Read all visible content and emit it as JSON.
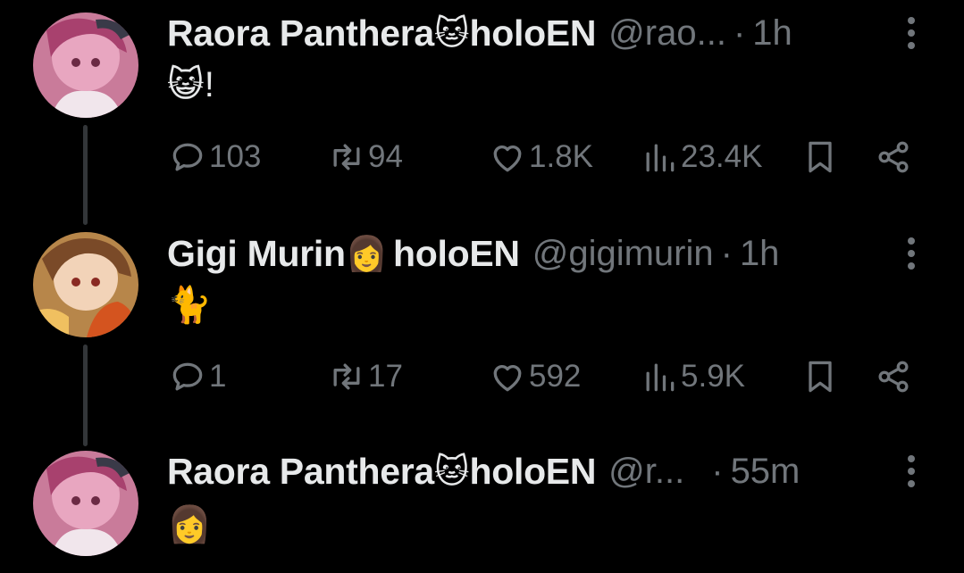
{
  "posts": [
    {
      "name": "Raora Panthera",
      "name_emoji": "🐱",
      "name_suffix": "holoEN",
      "handle": "@rao...",
      "dot": "·",
      "time": "1h",
      "text": "😺!",
      "stats": {
        "replies": "103",
        "reposts": "94",
        "likes": "1.8K",
        "views": "23.4K"
      }
    },
    {
      "name": "Gigi Murin",
      "name_emoji": "👩",
      "name_suffix": "holoEN",
      "handle": "@gigimurin",
      "dot": "·",
      "time": "1h",
      "text": "🐈",
      "stats": {
        "replies": "1",
        "reposts": "17",
        "likes": "592",
        "views": "5.9K"
      }
    },
    {
      "name": "Raora Panthera",
      "name_emoji": "🐱",
      "name_suffix": "holoEN",
      "handle": "@r...",
      "dot": "·",
      "time": "55m",
      "text": "👩"
    }
  ],
  "colors": {
    "background": "#000000",
    "text": "#e7e9ea",
    "muted": "#71767b",
    "thread_line": "#333639"
  },
  "icons": [
    "reply-icon",
    "repost-icon",
    "like-icon",
    "views-icon",
    "bookmark-icon",
    "share-icon",
    "more-icon"
  ]
}
